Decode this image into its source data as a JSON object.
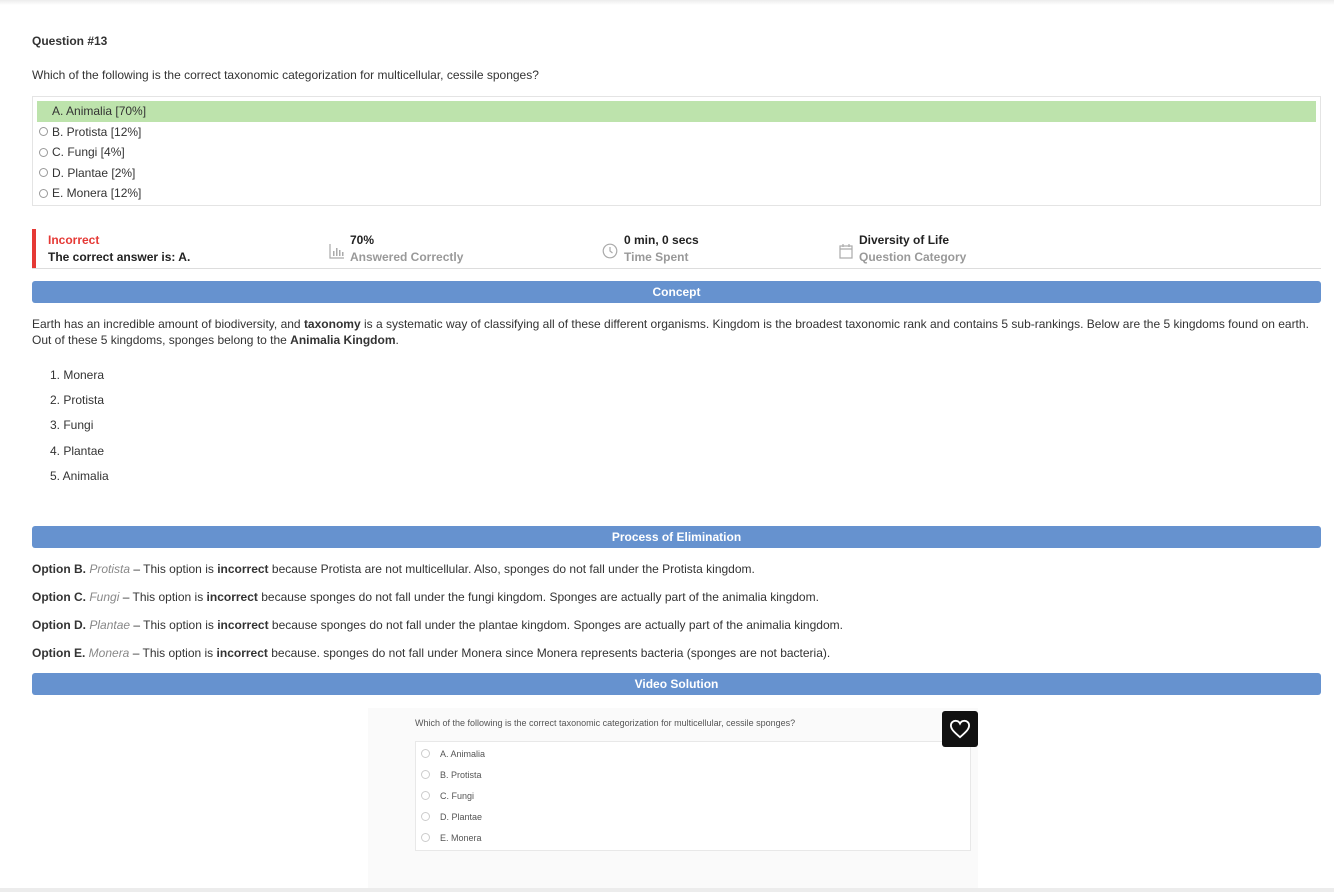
{
  "question": {
    "title": "Question #13",
    "text": "Which of the following is the correct taxonomic categorization for multicellular, cessile sponges?",
    "choices": [
      {
        "label": "A. Animalia [70%]",
        "correct": true
      },
      {
        "label": "B. Protista [12%]",
        "correct": false
      },
      {
        "label": "C. Fungi [4%]",
        "correct": false
      },
      {
        "label": "D. Plantae [2%]",
        "correct": false
      },
      {
        "label": "E. Monera [12%]",
        "correct": false
      }
    ]
  },
  "result": {
    "status": "Incorrect",
    "correct_answer": "The correct answer is: A.",
    "percent": "70%",
    "percent_label": "Answered Correctly",
    "time": "0 min, 0 secs",
    "time_label": "Time Spent",
    "category": "Diversity of Life",
    "category_label": "Question Category"
  },
  "concept": {
    "banner": "Concept",
    "p1": "Earth has an incredible amount of biodiversity, and ",
    "p1_bold": "taxonomy",
    "p2": " is a systematic way of classifying all of these different organisms. Kingdom is the broadest taxonomic rank and contains 5 sub-rankings. Below are the 5 kingdoms found on earth. Out of these 5 kingdoms, sponges belong to the ",
    "p2_bold": "Animalia Kingdom",
    "p3": ".",
    "list": [
      "1. Monera",
      "2. Protista",
      "3. Fungi",
      "4. Plantae",
      "5. Animalia"
    ]
  },
  "elimination": {
    "banner": "Process of Elimination",
    "items": [
      {
        "opt": "Option B.",
        "name": "Protista",
        "dash": " – This option is ",
        "bold": "incorrect",
        "rest": " because Protista are not multicellular. Also, sponges do not fall under the Protista kingdom."
      },
      {
        "opt": "Option C.",
        "name": "Fungi",
        "dash": " – This option is ",
        "bold": "incorrect",
        "rest": " because sponges do not fall under the fungi kingdom. Sponges are actually part of the animalia kingdom."
      },
      {
        "opt": "Option D.",
        "name": "Plantae",
        "dash": " – This option is ",
        "bold": "incorrect",
        "rest": " because sponges do not fall under the plantae kingdom. Sponges are actually part of the animalia kingdom."
      },
      {
        "opt": "Option E.",
        "name": "Monera",
        "dash": " – This option is ",
        "bold": "incorrect",
        "rest": " because. sponges do not fall under Monera since Monera represents bacteria (sponges are not bacteria)."
      }
    ]
  },
  "video": {
    "banner": "Video Solution",
    "question": "Which of the following is the correct taxonomic categorization for multicellular, cessile sponges?",
    "choices": [
      "A. Animalia",
      "B. Protista",
      "C. Fungi",
      "D. Plantae",
      "E. Monera"
    ]
  },
  "icons": {
    "stats": "bar-chart-icon",
    "time": "clock-icon",
    "category": "calendar-icon",
    "heart": "heart-icon"
  },
  "colors": {
    "accent": "#6692cf",
    "incorrect": "#e53935",
    "correct_fill": "#bde3ac"
  }
}
